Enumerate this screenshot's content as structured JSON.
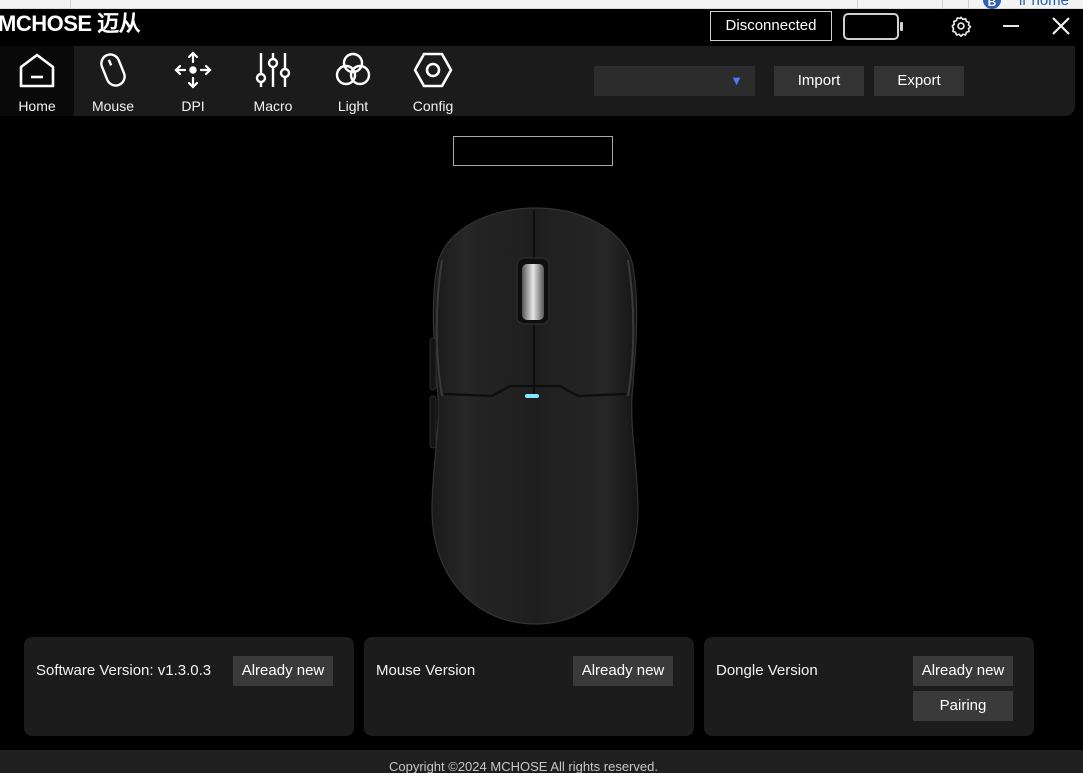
{
  "browser_strip": {
    "avatar_letter": "B",
    "text": "ir nome"
  },
  "title_bar": {
    "brand": "MCHOSE 迈从",
    "connection_status": "Disconnected",
    "battery_icon": "battery-icon",
    "settings_icon": "gear-icon",
    "minimize_icon": "minimize-icon",
    "close_icon": "close-icon"
  },
  "nav": {
    "items": [
      {
        "label": "Home",
        "icon": "home-icon"
      },
      {
        "label": "Mouse",
        "icon": "mouse-icon"
      },
      {
        "label": "DPI",
        "icon": "dpi-move-icon"
      },
      {
        "label": "Macro",
        "icon": "sliders-icon"
      },
      {
        "label": "Light",
        "icon": "rgb-circles-icon"
      },
      {
        "label": "Config",
        "icon": "hexagon-nut-icon"
      }
    ],
    "active": "Home"
  },
  "header": {
    "profile_select_value": "",
    "import_label": "Import",
    "export_label": "Export"
  },
  "device_name_value": "",
  "versions": [
    {
      "label": "Software Version: v1.3.0.3",
      "button": "Already new"
    },
    {
      "label": "Mouse Version",
      "button": "Already new"
    },
    {
      "label": "Dongle Version",
      "button": "Already new",
      "second_button": "Pairing"
    }
  ],
  "footer": {
    "copyright": "Copyright ©2024 MCHOSE All rights reserved."
  },
  "colors": {
    "background": "#000000",
    "panel": "#1b1b1b",
    "accent_arrow": "#4b7bff",
    "led": "#7fe8ff"
  }
}
